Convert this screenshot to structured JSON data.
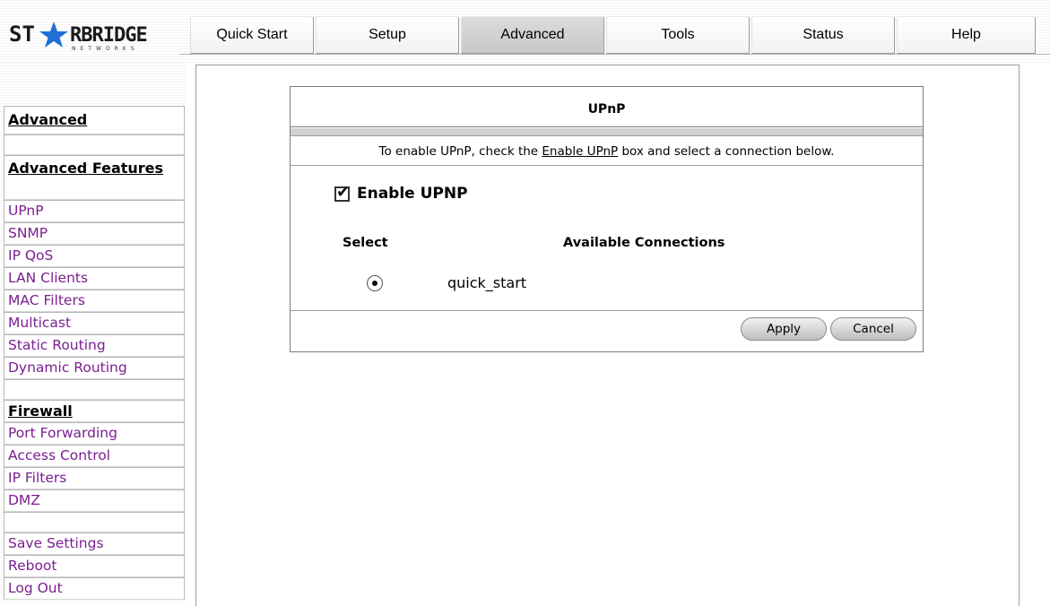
{
  "brand": {
    "logo_text": "STARBRIDGE",
    "logo_sub": "NETWORKS",
    "logo_icon": "star-icon"
  },
  "tabs": [
    {
      "label": "Quick Start",
      "active": false
    },
    {
      "label": "Setup",
      "active": false
    },
    {
      "label": "Advanced",
      "active": true
    },
    {
      "label": "Tools",
      "active": false
    },
    {
      "label": "Status",
      "active": false
    },
    {
      "label": "Help",
      "active": false
    }
  ],
  "sidebar": {
    "advanced_heading": "Advanced",
    "advanced_features_heading": "Advanced Features",
    "items": [
      "UPnP",
      "SNMP",
      "IP QoS",
      "LAN Clients",
      "MAC Filters",
      "Multicast",
      "Static Routing",
      "Dynamic Routing"
    ],
    "firewall_heading": "Firewall",
    "firewall_items": [
      "Port Forwarding",
      "Access Control",
      "IP Filters",
      "DMZ"
    ],
    "system_items": [
      "Save Settings",
      "Reboot",
      "Log Out"
    ]
  },
  "panel": {
    "title": "UPnP",
    "instruction_pre": "To enable UPnP, check the ",
    "instruction_link": "Enable UPnP",
    "instruction_post": " box and select a connection below.",
    "enable_label": "Enable UPNP",
    "enable_checked": true,
    "col_select": "Select",
    "col_available": "Available Connections",
    "connections": [
      {
        "name": "quick_start",
        "selected": true
      }
    ],
    "apply_label": "Apply",
    "cancel_label": "Cancel"
  },
  "colors": {
    "link": "#7a1f8f",
    "border": "#7d7d7d",
    "tab_active": "#c8c8c8"
  }
}
